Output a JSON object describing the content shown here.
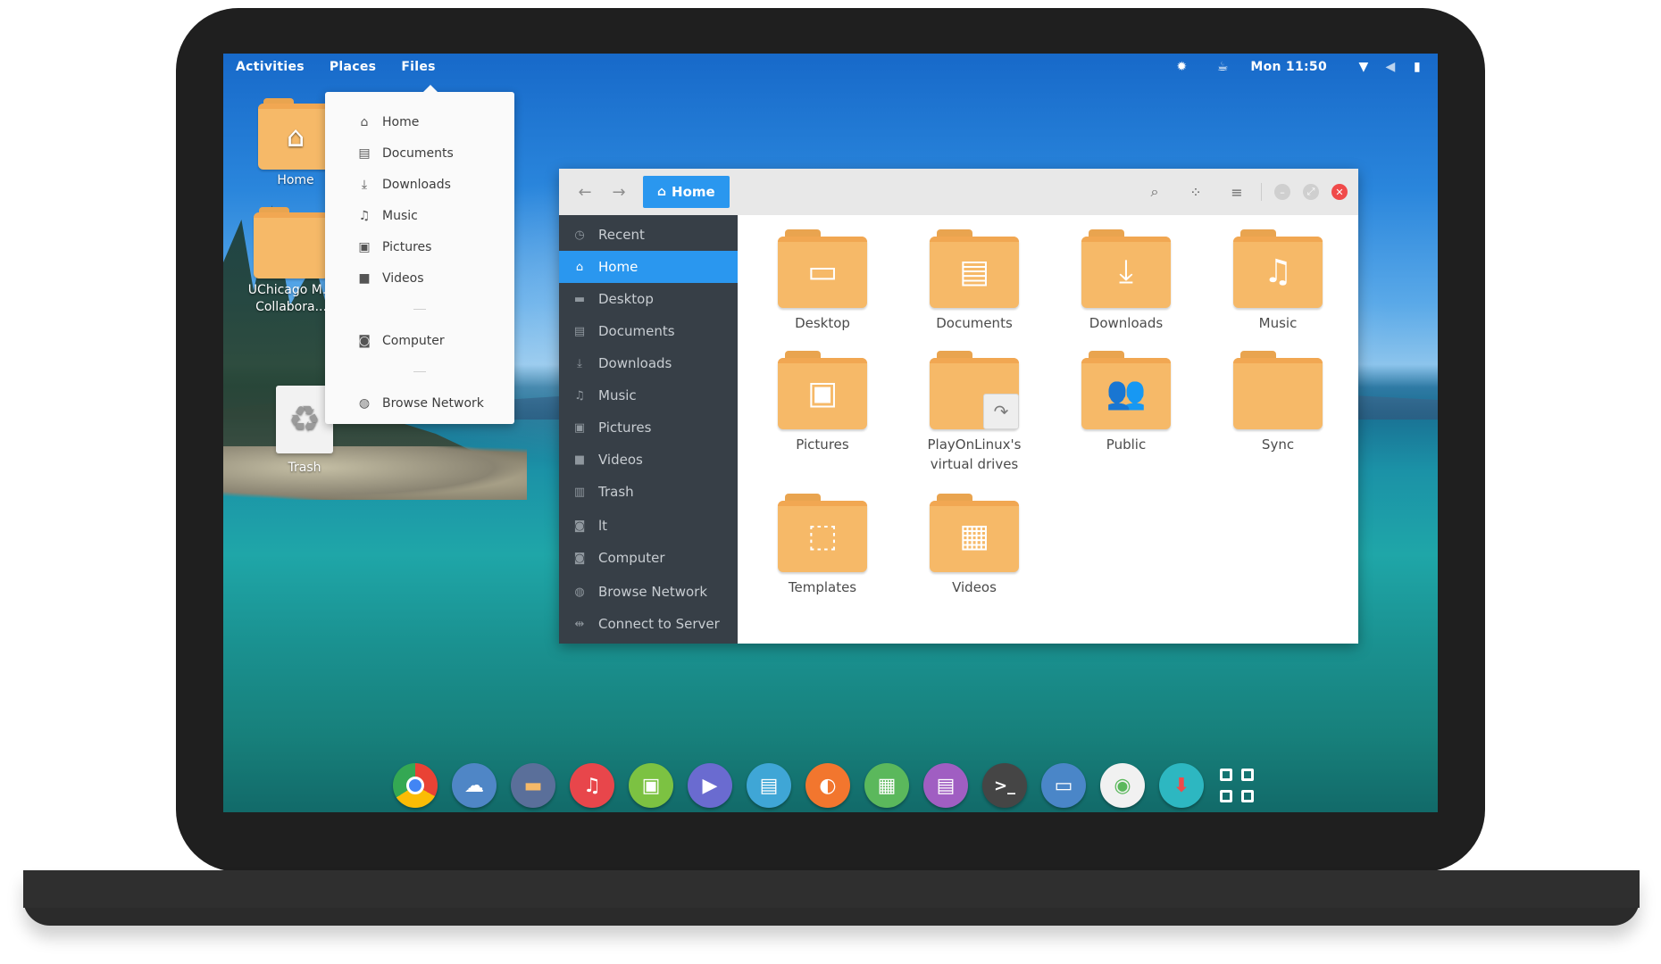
{
  "top_panel": {
    "activities": "Activities",
    "places": "Places",
    "files": "Files",
    "clock": "Mon 11:50",
    "status_icons": [
      "update-icon",
      "coffee-icon",
      "wifi-icon",
      "volume-icon",
      "battery-icon"
    ]
  },
  "desktop": {
    "icons": [
      {
        "label": "Home",
        "icon": "home-icon"
      },
      {
        "label": "UChicago M... Collabora...",
        "icon": "folder-icon"
      },
      {
        "label": "Trash",
        "icon": "trash-icon"
      }
    ]
  },
  "places_menu": {
    "items": [
      {
        "label": "Home",
        "icon": "home-icon"
      },
      {
        "label": "Documents",
        "icon": "document-icon"
      },
      {
        "label": "Downloads",
        "icon": "download-icon"
      },
      {
        "label": "Music",
        "icon": "music-icon"
      },
      {
        "label": "Pictures",
        "icon": "picture-icon"
      },
      {
        "label": "Videos",
        "icon": "video-icon"
      },
      {
        "label": "Computer",
        "icon": "computer-icon"
      },
      {
        "label": "Browse Network",
        "icon": "network-icon"
      }
    ]
  },
  "file_manager": {
    "path_label": "Home",
    "sidebar": [
      {
        "label": "Recent",
        "icon": "clock-icon"
      },
      {
        "label": "Home",
        "icon": "home-icon",
        "active": true
      },
      {
        "label": "Desktop",
        "icon": "desktop-icon"
      },
      {
        "label": "Documents",
        "icon": "document-icon"
      },
      {
        "label": "Downloads",
        "icon": "download-icon"
      },
      {
        "label": "Music",
        "icon": "music-icon"
      },
      {
        "label": "Pictures",
        "icon": "picture-icon"
      },
      {
        "label": "Videos",
        "icon": "video-icon"
      },
      {
        "label": "Trash",
        "icon": "trash-icon"
      },
      {
        "label": "lt",
        "icon": "drive-icon"
      },
      {
        "label": "Computer",
        "icon": "computer-icon"
      },
      {
        "label": "Browse Network",
        "icon": "network-icon"
      },
      {
        "label": "Connect to Server",
        "icon": "server-icon"
      }
    ],
    "folders": [
      {
        "label": "Desktop",
        "icon": "desktop-icon"
      },
      {
        "label": "Documents",
        "icon": "document-icon"
      },
      {
        "label": "Downloads",
        "icon": "download-icon"
      },
      {
        "label": "Music",
        "icon": "music-icon"
      },
      {
        "label": "Pictures",
        "icon": "picture-icon"
      },
      {
        "label": "PlayOnLinux's virtual drives",
        "icon": "link-icon"
      },
      {
        "label": "Public",
        "icon": "people-icon"
      },
      {
        "label": "Sync",
        "icon": "folder-icon"
      },
      {
        "label": "Templates",
        "icon": "template-icon"
      },
      {
        "label": "Videos",
        "icon": "video-icon"
      }
    ]
  },
  "dock": {
    "apps": [
      {
        "name": "chrome-icon",
        "color": "#e8e8e8"
      },
      {
        "name": "cloud-icon",
        "color": "#4f86c6"
      },
      {
        "name": "files-icon",
        "color": "#5a6f9a"
      },
      {
        "name": "music-icon",
        "color": "#e8464b"
      },
      {
        "name": "image-viewer-icon",
        "color": "#7cc242"
      },
      {
        "name": "video-player-icon",
        "color": "#6a6bd0"
      },
      {
        "name": "text-editor-icon",
        "color": "#3fa6d6"
      },
      {
        "name": "photo-icon",
        "color": "#f2762e"
      },
      {
        "name": "spreadsheet-icon",
        "color": "#5bb85c"
      },
      {
        "name": "document-viewer-icon",
        "color": "#a05ec2"
      },
      {
        "name": "terminal-icon",
        "color": "#454545"
      },
      {
        "name": "remote-desktop-icon",
        "color": "#4a86c8"
      },
      {
        "name": "settings-toggle-icon",
        "color": "#f1f1f1"
      },
      {
        "name": "software-updater-icon",
        "color": "#2db7c1"
      }
    ]
  },
  "colors": {
    "accent": "#2a97ef",
    "folder": "#f6b968",
    "sidebar": "#373f47",
    "close_button": "#f04a4a"
  }
}
